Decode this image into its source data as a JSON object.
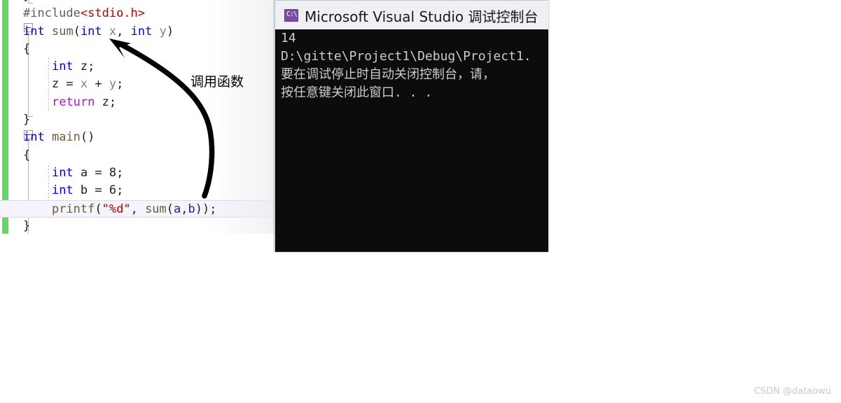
{
  "editor": {
    "name": "visual-studio-code-editor",
    "change_bar_color": "#63d963",
    "current_line_index": 12,
    "lines": [
      {
        "indent": 0,
        "tokens": [
          {
            "t": "}",
            "c": "punc"
          }
        ]
      },
      {
        "indent": 0,
        "tokens": [
          {
            "t": "#include",
            "c": "pp"
          },
          {
            "t": "<stdio.h>",
            "c": "ppfile"
          }
        ]
      },
      {
        "indent": 0,
        "tokens": [
          {
            "t": "int",
            "c": "kw"
          },
          {
            "t": " ",
            "c": "punc"
          },
          {
            "t": "sum",
            "c": "fn"
          },
          {
            "t": "(",
            "c": "punc"
          },
          {
            "t": "int",
            "c": "kw"
          },
          {
            "t": " ",
            "c": "punc"
          },
          {
            "t": "x",
            "c": "param"
          },
          {
            "t": ", ",
            "c": "punc"
          },
          {
            "t": "int",
            "c": "kw"
          },
          {
            "t": " ",
            "c": "punc"
          },
          {
            "t": "y",
            "c": "param"
          },
          {
            "t": ")",
            "c": "punc"
          }
        ]
      },
      {
        "indent": 0,
        "tokens": [
          {
            "t": "{",
            "c": "punc"
          }
        ]
      },
      {
        "indent": 1,
        "tokens": [
          {
            "t": "int",
            "c": "kw"
          },
          {
            "t": " z;",
            "c": "punc"
          }
        ]
      },
      {
        "indent": 1,
        "tokens": [
          {
            "t": "z = ",
            "c": "punc"
          },
          {
            "t": "x",
            "c": "param"
          },
          {
            "t": " + ",
            "c": "punc"
          },
          {
            "t": "y",
            "c": "param"
          },
          {
            "t": ";",
            "c": "punc"
          }
        ]
      },
      {
        "indent": 1,
        "tokens": [
          {
            "t": "return",
            "c": "ret"
          },
          {
            "t": " z;",
            "c": "punc"
          }
        ]
      },
      {
        "indent": 0,
        "tokens": [
          {
            "t": "}",
            "c": "punc"
          }
        ]
      },
      {
        "indent": 0,
        "tokens": [
          {
            "t": "int",
            "c": "kw"
          },
          {
            "t": " ",
            "c": "punc"
          },
          {
            "t": "main",
            "c": "fn"
          },
          {
            "t": "()",
            "c": "punc"
          }
        ]
      },
      {
        "indent": 0,
        "tokens": [
          {
            "t": "{",
            "c": "punc"
          }
        ]
      },
      {
        "indent": 1,
        "tokens": [
          {
            "t": "int",
            "c": "kw"
          },
          {
            "t": " a = 8;",
            "c": "punc"
          }
        ]
      },
      {
        "indent": 1,
        "tokens": [
          {
            "t": "int",
            "c": "kw"
          },
          {
            "t": " b = 6;",
            "c": "punc"
          }
        ]
      },
      {
        "indent": 1,
        "tokens": [
          {
            "t": "printf",
            "c": "fn"
          },
          {
            "t": "(",
            "c": "punc"
          },
          {
            "t": "\"%d\"",
            "c": "str"
          },
          {
            "t": ", ",
            "c": "punc"
          },
          {
            "t": "sum",
            "c": "fn"
          },
          {
            "t": "(",
            "c": "punc"
          },
          {
            "t": "a",
            "c": "var"
          },
          {
            "t": ",",
            "c": "punc"
          },
          {
            "t": "b",
            "c": "var"
          },
          {
            "t": "));",
            "c": "punc"
          }
        ]
      },
      {
        "indent": 0,
        "tokens": [
          {
            "t": "}",
            "c": "punc"
          }
        ]
      }
    ],
    "plain_text": "#include<stdio.h>\nint sum(int x, int y)\n{\n    int z;\n    z = x + y;\n    return z;\n}\nint main()\n{\n    int a = 8;\n    int b = 6;\n    printf(\"%d\", sum(a,b));\n}"
  },
  "annotation": {
    "label": "调用函数",
    "arrow_color": "#000000",
    "arrow_description": "hand-drawn curved arrow from printf sum(a,b) call up to sum(int x parameter"
  },
  "console": {
    "title": "Microsoft Visual Studio 调试控制台",
    "icon": "console-icon",
    "icon_glyph": "C:\\",
    "titlebar_color": "#eef0f4",
    "background_color": "#0c0c0c",
    "text_color": "#cccccc",
    "lines": [
      "14",
      "D:\\gitte\\Project1\\Debug\\Project1.",
      "要在调试停止时自动关闭控制台，请，",
      "按任意键关闭此窗口. . ."
    ]
  },
  "watermark": {
    "text": "CSDN @dataowu"
  }
}
